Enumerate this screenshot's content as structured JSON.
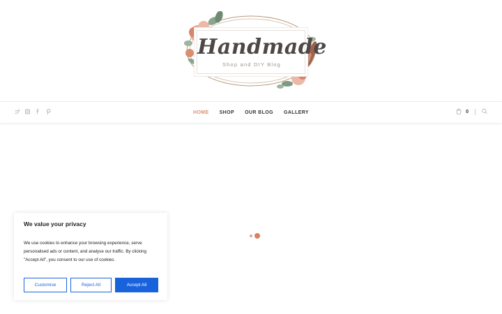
{
  "logo": {
    "title": "Handmade",
    "subtitle": "Shop and DIY Blog"
  },
  "nav": {
    "items": [
      {
        "label": "HOME",
        "active": true
      },
      {
        "label": "SHOP",
        "active": false
      },
      {
        "label": "OUR BLOG",
        "active": false
      },
      {
        "label": "GALLERY",
        "active": false
      }
    ],
    "cart_count": "0",
    "social_icons": [
      "twitter-icon",
      "instagram-icon",
      "facebook-icon",
      "pinterest-icon"
    ]
  },
  "cookie": {
    "title": "We value your privacy",
    "text": "We use cookies to enhance your browsing experience, serve personalised ads or content, and analyse our traffic. By clicking \"Accept All\", you consent to our use of cookies.",
    "customise_label": "Customise",
    "reject_label": "Reject All",
    "accept_label": "Accept All"
  },
  "colors": {
    "accent": "#d98e70",
    "cookie_button": "#1863dc"
  }
}
